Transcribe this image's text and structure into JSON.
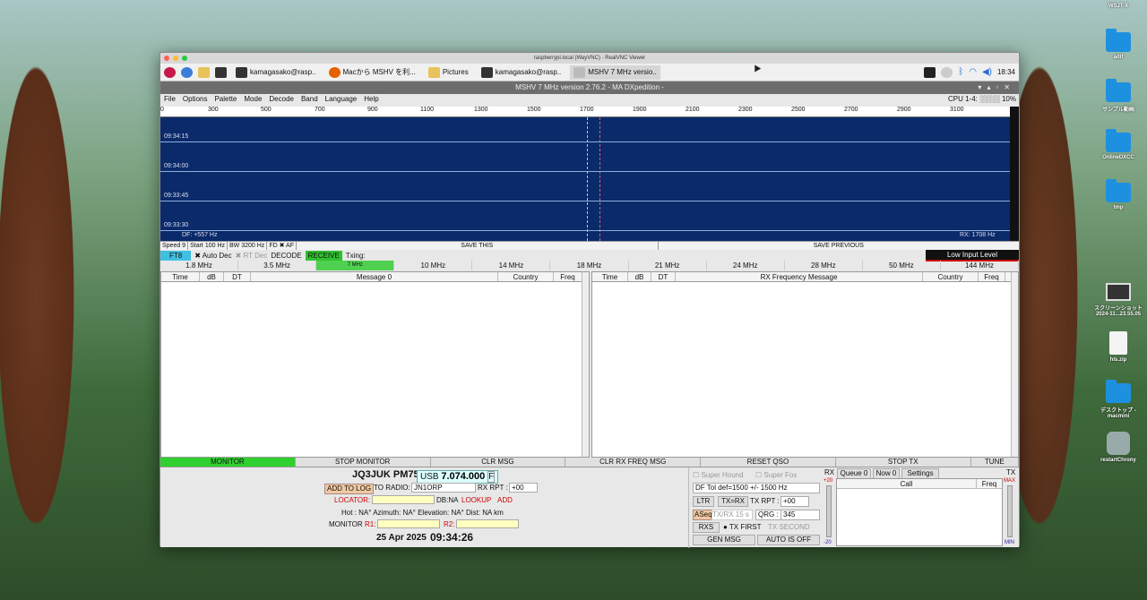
{
  "desktop": {
    "icons": [
      {
        "label": "WSJT-X",
        "kind": "app"
      },
      {
        "label": "adif",
        "kind": "folder"
      },
      {
        "label": "サンプル動画",
        "kind": "folder"
      },
      {
        "label": "OnlineDXCC",
        "kind": "folder"
      },
      {
        "label": "tmp",
        "kind": "folder"
      },
      {
        "label": "スクリーンショット\n2024-11...23.55.05",
        "kind": "image"
      },
      {
        "label": "hls.zip",
        "kind": "file"
      },
      {
        "label": "デスクトップ - macmini",
        "kind": "folder"
      },
      {
        "label": "restartChrony",
        "kind": "app"
      }
    ]
  },
  "vnc": {
    "title": "raspberrypi.local (WayVNC) - RealVNC Viewer"
  },
  "taskbar": {
    "items": [
      "kamagasako@rasp..",
      "Macから MSHV を利...",
      "Pictures",
      "kamagasako@rasp..",
      "MSHV 7 MHz versio.."
    ],
    "clock": "18:34"
  },
  "app": {
    "title": "MSHV 7 MHz version 2.76.2 - MA DXpedition -",
    "menu": [
      "File",
      "Options",
      "Palette",
      "Mode",
      "Decode",
      "Band",
      "Language",
      "Help"
    ],
    "cpu": "CPU 1-4: ░░░░ 10%",
    "ruler": [
      "0",
      "300",
      "500",
      "700",
      "900",
      "1100",
      "1300",
      "1500",
      "1700",
      "1900",
      "2100",
      "2300",
      "2500",
      "2700",
      "2900",
      "3100"
    ],
    "times": [
      "09:34:15",
      "09:34:00",
      "09:33:45",
      "09:33:30"
    ],
    "df": "DF: +557 Hz",
    "rx": "RX: 1708 Hz",
    "controls": {
      "speed": "Speed 9",
      "start": "Start 100 Hz",
      "bw": "BW 3200 Hz",
      "fd": "FD",
      "af": "✖ AF",
      "save_this": "SAVE THIS",
      "save_prev": "SAVE PREVIOUS"
    },
    "mode": {
      "name": "FT8",
      "auto_dec": "✖ Auto Dec",
      "rt_dec": "✖ RT Dec",
      "decode": "DECODE",
      "receive": "RECEIVE",
      "txing": "Txing:",
      "input_level": "Low Input Level"
    },
    "bands": [
      "1.8 MHz",
      "3.5 MHz",
      "7 MHz",
      "10 MHz",
      "14 MHz",
      "18 MHz",
      "21 MHz",
      "24 MHz",
      "28 MHz",
      "50 MHz",
      "144 MHz"
    ],
    "left_cols": [
      "Time",
      "dB",
      "DT",
      "Message 0",
      "Country",
      "Freq"
    ],
    "right_cols": [
      "Time",
      "dB",
      "DT",
      "RX Frequency Message",
      "Country",
      "Freq"
    ],
    "buttons": [
      "MONITOR",
      "STOP MONITOR",
      "CLR MSG",
      "CLR RX FREQ MSG",
      "RESET QSO",
      "STOP TX",
      "TUNE"
    ],
    "station": {
      "call": "JQ3JUK PM75",
      "mode": "USB",
      "freq": "7.074.000",
      "f": "F",
      "add_log": "ADD TO LOG",
      "to_radio": "TO RADIO:",
      "to_radio_val": "JN1ORP",
      "rx_rpt": "RX RPT :",
      "rx_rpt_val": "+00",
      "locator": "LOCATOR:",
      "db": "DB:NA",
      "lookup": "LOOKUP",
      "add": "ADD",
      "info": "Hot : NA°   Azimuth: NA°   Elevation: NA°   Dist: NA km",
      "monitor": "MONITOR",
      "r1": "R1:",
      "r2": "R2:",
      "date": "25 Apr 2025",
      "time": "09:34:26"
    },
    "txpanel": {
      "super_hound": "Super Hound",
      "super_fox": "Super Fox",
      "df_tol": "DF Tol def=1500 +/-  1500  Hz",
      "ltr": "LTR",
      "txrx": "TX=RX",
      "tx_rpt": "TX RPT :",
      "tx_rpt_val": "+00",
      "aseq": "ASeq",
      "txrx15": "TX/RX 15  s",
      "qrg": "QRG :",
      "qrg_val": "345",
      "rxs": "RXS",
      "tx_first": "● TX FIRST",
      "tx_second": "TX SECOND",
      "gen_msg": "GEN MSG",
      "auto_off": "AUTO IS OFF"
    },
    "queue": {
      "rx": "RX",
      "tx": "TX",
      "queue": "Queue 0",
      "now": "Now 0",
      "settings": "Settings",
      "call": "Call",
      "freq": "Freq",
      "plus20": "+20",
      "minus20": "-20",
      "max": "MAX",
      "min": "MIN"
    }
  }
}
